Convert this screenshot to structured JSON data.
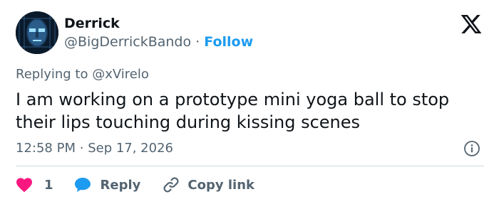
{
  "author": {
    "name": "Derrick",
    "handle": "@BigDerrickBando",
    "separator": "·",
    "follow_label": "Follow"
  },
  "brand": {
    "icon": "x-logo-icon"
  },
  "reply_context": {
    "prefix": "Replying to",
    "handle": "@xVirelo"
  },
  "tweet": {
    "text": "I am working on a prototype mini yoga ball to stop their lips touching during kissing scenes",
    "time": "12:58 PM",
    "separator": "·",
    "date": "Sep 17, 2026"
  },
  "actions": {
    "like_count": "1",
    "reply_label": "Reply",
    "copy_link_label": "Copy link"
  },
  "colors": {
    "like": "#f91880",
    "reply": "#1d9bf0",
    "follow": "#1d9bf0",
    "secondary_text": "#536471"
  }
}
